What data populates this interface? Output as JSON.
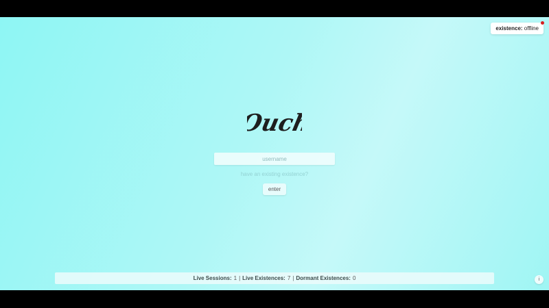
{
  "status": {
    "key": "existence:",
    "value": "offline",
    "dot_color": "#d62020"
  },
  "logo": {
    "text": "Ouch"
  },
  "login": {
    "username_placeholder": "username",
    "existing_link": "have an existing existence?",
    "enter_label": "enter"
  },
  "stats": {
    "live_sessions_label": "Live Sessions:",
    "live_sessions_value": "1",
    "live_existences_label": "Live Existences:",
    "live_existences_value": "7",
    "dormant_existences_label": "Dormant Existences:",
    "dormant_existences_value": "0",
    "separator": "|"
  },
  "info": {
    "icon": "info-icon",
    "glyph": "i"
  },
  "colors": {
    "background": "#aef7f6",
    "offline_dot": "#d62020"
  }
}
